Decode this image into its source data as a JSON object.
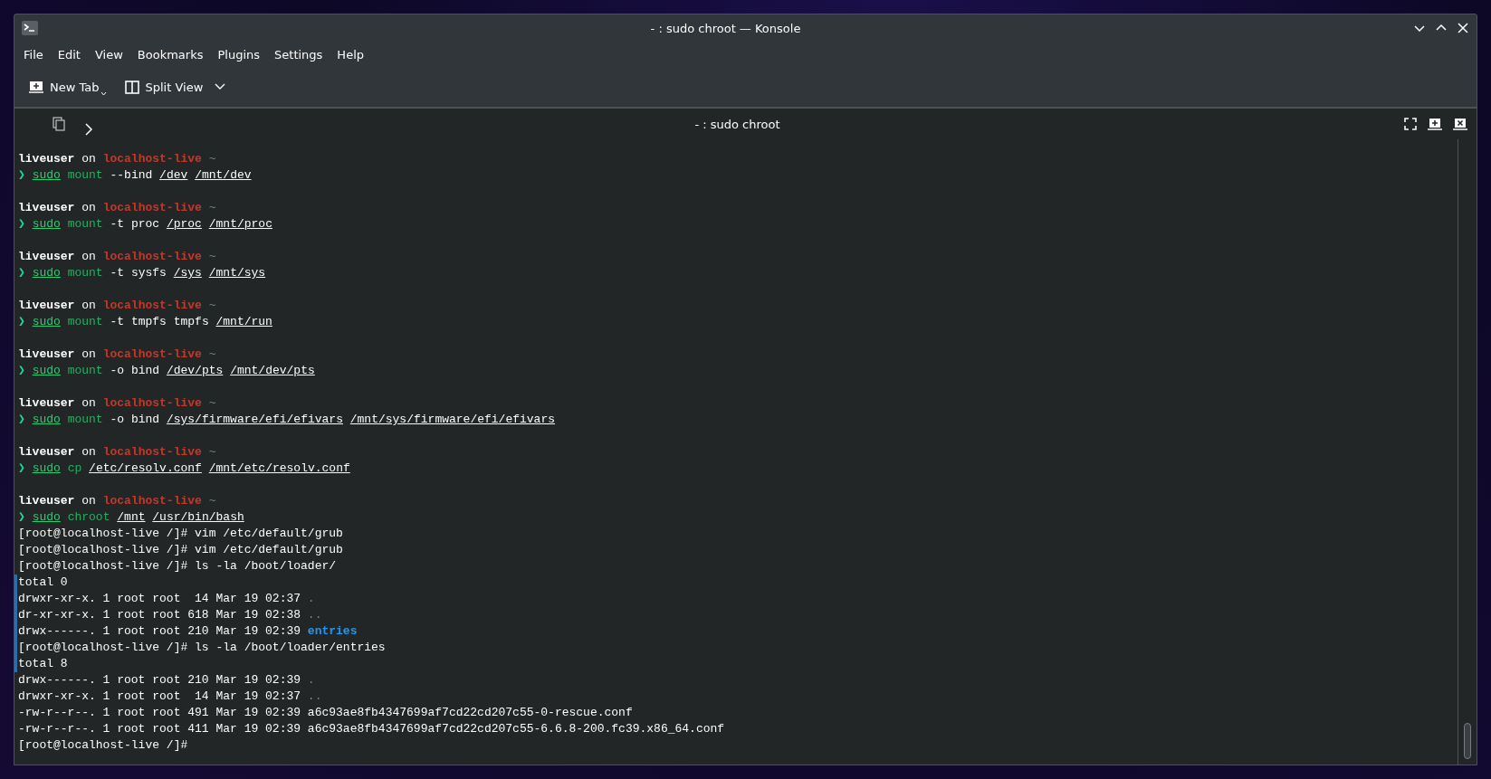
{
  "window": {
    "title": "- : sudo chroot — Konsole"
  },
  "menu": [
    "File",
    "Edit",
    "View",
    "Bookmarks",
    "Plugins",
    "Settings",
    "Help"
  ],
  "toolbar": [
    {
      "label": "New Tab",
      "kind": "newtab"
    },
    {
      "label": "Split View",
      "kind": "split"
    }
  ],
  "tab_header": {
    "title": "- : sudo chroot"
  },
  "sessions": [
    {
      "prompt": [
        {
          "text": "liveuser",
          "kind": "user"
        },
        {
          "text": " on ",
          "kind": "plain"
        },
        {
          "text": "localhost-live",
          "kind": "host"
        },
        {
          "text": " ~",
          "kind": "dim"
        }
      ],
      "command": [
        {
          "text": "❯ ",
          "kind": "arrow"
        },
        {
          "text": "sudo",
          "kind": "sudo"
        },
        {
          "text": " mount",
          "kind": "program"
        },
        {
          "text": " --bind",
          "kind": "plain"
        },
        {
          "text": " /dev /mnt/dev",
          "kind": "paths"
        }
      ]
    },
    {
      "prompt": [
        {
          "text": "liveuser",
          "kind": "user"
        },
        {
          "text": " on ",
          "kind": "plain"
        },
        {
          "text": "localhost-live",
          "kind": "host"
        },
        {
          "text": " ~",
          "kind": "dim"
        }
      ],
      "command": [
        {
          "text": "❯ ",
          "kind": "arrow"
        },
        {
          "text": "sudo",
          "kind": "sudo"
        },
        {
          "text": " mount",
          "kind": "program"
        },
        {
          "text": " -t proc",
          "kind": "plain"
        },
        {
          "text": " /proc /mnt/proc",
          "kind": "paths"
        }
      ]
    },
    {
      "prompt": [
        {
          "text": "liveuser",
          "kind": "user"
        },
        {
          "text": " on ",
          "kind": "plain"
        },
        {
          "text": "localhost-live",
          "kind": "host"
        },
        {
          "text": " ~",
          "kind": "dim"
        }
      ],
      "command": [
        {
          "text": "❯ ",
          "kind": "arrow"
        },
        {
          "text": "sudo",
          "kind": "sudo"
        },
        {
          "text": " mount",
          "kind": "program"
        },
        {
          "text": " -t sysfs",
          "kind": "plain"
        },
        {
          "text": " /sys /mnt/sys",
          "kind": "paths"
        }
      ]
    },
    {
      "prompt": [
        {
          "text": "liveuser",
          "kind": "user"
        },
        {
          "text": " on ",
          "kind": "plain"
        },
        {
          "text": "localhost-live",
          "kind": "host"
        },
        {
          "text": " ~",
          "kind": "dim"
        }
      ],
      "command": [
        {
          "text": "❯ ",
          "kind": "arrow"
        },
        {
          "text": "sudo",
          "kind": "sudo"
        },
        {
          "text": " mount",
          "kind": "program"
        },
        {
          "text": " -t tmpfs tmpfs",
          "kind": "plain"
        },
        {
          "text": " /mnt/run",
          "kind": "paths"
        }
      ]
    },
    {
      "prompt": [
        {
          "text": "liveuser",
          "kind": "user"
        },
        {
          "text": " on ",
          "kind": "plain"
        },
        {
          "text": "localhost-live",
          "kind": "host"
        },
        {
          "text": " ~",
          "kind": "dim"
        }
      ],
      "command": [
        {
          "text": "❯ ",
          "kind": "arrow"
        },
        {
          "text": "sudo",
          "kind": "sudo"
        },
        {
          "text": " mount",
          "kind": "program"
        },
        {
          "text": " -o bind",
          "kind": "plain"
        },
        {
          "text": " /dev/pts /mnt/dev/pts",
          "kind": "paths"
        }
      ]
    },
    {
      "prompt": [
        {
          "text": "liveuser",
          "kind": "user"
        },
        {
          "text": " on ",
          "kind": "plain"
        },
        {
          "text": "localhost-live",
          "kind": "host"
        },
        {
          "text": " ~",
          "kind": "dim"
        }
      ],
      "command": [
        {
          "text": "❯ ",
          "kind": "arrow"
        },
        {
          "text": "sudo",
          "kind": "sudo"
        },
        {
          "text": " mount",
          "kind": "program"
        },
        {
          "text": " -o bind",
          "kind": "plain"
        },
        {
          "text": " /sys/firmware/efi/efivars /mnt/sys/firmware/efi/efivars",
          "kind": "paths"
        }
      ]
    },
    {
      "prompt": [
        {
          "text": "liveuser",
          "kind": "user"
        },
        {
          "text": " on ",
          "kind": "plain"
        },
        {
          "text": "localhost-live",
          "kind": "host"
        },
        {
          "text": " ~",
          "kind": "dim"
        }
      ],
      "command": [
        {
          "text": "❯ ",
          "kind": "arrow"
        },
        {
          "text": "sudo",
          "kind": "sudo"
        },
        {
          "text": " cp",
          "kind": "program"
        },
        {
          "text": " /etc/resolv.conf /mnt/etc/resolv.conf",
          "kind": "paths"
        }
      ]
    },
    {
      "prompt": [
        {
          "text": "liveuser",
          "kind": "user"
        },
        {
          "text": " on ",
          "kind": "plain"
        },
        {
          "text": "localhost-live",
          "kind": "host"
        },
        {
          "text": " ~",
          "kind": "dim"
        }
      ],
      "command": [
        {
          "text": "❯ ",
          "kind": "arrow"
        },
        {
          "text": "sudo",
          "kind": "sudo"
        },
        {
          "text": " chroot",
          "kind": "program"
        },
        {
          "text": " /mnt /usr/bin/bash",
          "kind": "paths"
        }
      ],
      "output": [
        {
          "marked": false,
          "segments": [
            {
              "text": "[root@localhost-live /]# vim /etc/default/grub",
              "kind": "plain"
            }
          ]
        },
        {
          "marked": false,
          "segments": [
            {
              "text": "[root@localhost-live /]# vim /etc/default/grub",
              "kind": "plain"
            }
          ]
        },
        {
          "marked": false,
          "segments": [
            {
              "text": "[root@localhost-live /]# ls -la /boot/loader/",
              "kind": "plain"
            }
          ]
        },
        {
          "marked": true,
          "segments": [
            {
              "text": "total 0",
              "kind": "plain"
            }
          ]
        },
        {
          "marked": true,
          "segments": [
            {
              "text": "drwxr-xr-x. 1 root root  14 Mar 19 02:37 ",
              "kind": "plain"
            },
            {
              "text": ".",
              "kind": "dim"
            }
          ]
        },
        {
          "marked": true,
          "segments": [
            {
              "text": "dr-xr-xr-x. 1 root root 618 Mar 19 02:38 ",
              "kind": "plain"
            },
            {
              "text": "..",
              "kind": "dim"
            }
          ]
        },
        {
          "marked": true,
          "segments": [
            {
              "text": "drwx------. 1 root root 210 Mar 19 02:39 ",
              "kind": "plain"
            },
            {
              "text": "entries",
              "kind": "dir"
            }
          ]
        },
        {
          "marked": true,
          "segments": [
            {
              "text": "[root@localhost-live /]# ls -la /boot/loader/entries",
              "kind": "plain"
            }
          ]
        },
        {
          "marked": true,
          "segments": [
            {
              "text": "total 8",
              "kind": "plain"
            }
          ]
        },
        {
          "marked": false,
          "segments": [
            {
              "text": "drwx------. 1 root root 210 Mar 19 02:39 ",
              "kind": "plain"
            },
            {
              "text": ".",
              "kind": "dim"
            }
          ]
        },
        {
          "marked": false,
          "segments": [
            {
              "text": "drwxr-xr-x. 1 root root  14 Mar 19 02:37 ",
              "kind": "plain"
            },
            {
              "text": "..",
              "kind": "dim"
            }
          ]
        },
        {
          "marked": false,
          "segments": [
            {
              "text": "-rw-r--r--. 1 root root 491 Mar 19 02:39 a6c93ae8fb4347699af7cd22cd207c55-0-rescue.conf",
              "kind": "plain"
            }
          ]
        },
        {
          "marked": false,
          "segments": [
            {
              "text": "-rw-r--r--. 1 root root 411 Mar 19 02:39 a6c93ae8fb4347699af7cd22cd207c55-6.6.8-200.fc39.x86_64.conf",
              "kind": "plain"
            }
          ]
        },
        {
          "marked": false,
          "segments": [
            {
              "text": "[root@localhost-live /]#",
              "kind": "plain"
            }
          ]
        }
      ]
    }
  ]
}
